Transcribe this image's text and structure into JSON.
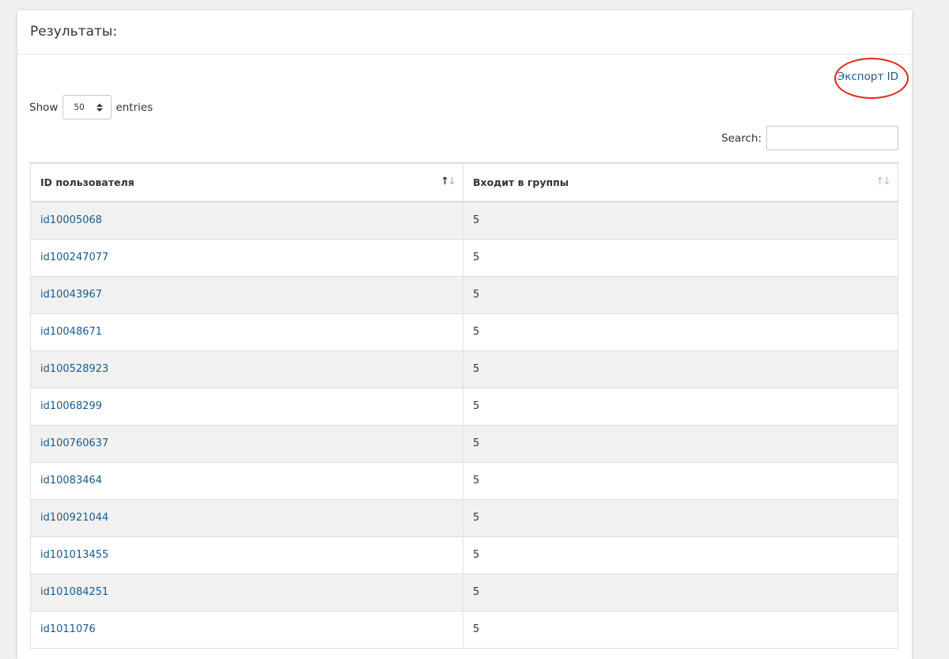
{
  "panel": {
    "title": "Результаты:",
    "export_label": "Экспорт ID"
  },
  "length": {
    "prefix": "Show",
    "value": "50",
    "suffix": "entries"
  },
  "search": {
    "label": "Search:",
    "value": ""
  },
  "table": {
    "columns": [
      "ID пользователя",
      "Входит в группы"
    ],
    "sort_up": "↑",
    "sort_down": "↓",
    "rows": [
      {
        "id": "id10005068",
        "groups": "5"
      },
      {
        "id": "id100247077",
        "groups": "5"
      },
      {
        "id": "id10043967",
        "groups": "5"
      },
      {
        "id": "id10048671",
        "groups": "5"
      },
      {
        "id": "id100528923",
        "groups": "5"
      },
      {
        "id": "id10068299",
        "groups": "5"
      },
      {
        "id": "id100760637",
        "groups": "5"
      },
      {
        "id": "id10083464",
        "groups": "5"
      },
      {
        "id": "id100921044",
        "groups": "5"
      },
      {
        "id": "id101013455",
        "groups": "5"
      },
      {
        "id": "id101084251",
        "groups": "5"
      },
      {
        "id": "id1011076",
        "groups": "5"
      }
    ]
  },
  "colors": {
    "link": "#1a5a8a",
    "annotation_circle": "#e2261b",
    "odd_row": "#f1f1f1"
  },
  "icons": {
    "select_arrows": "sort-updown-icon",
    "column_sort": "sort-icon"
  }
}
